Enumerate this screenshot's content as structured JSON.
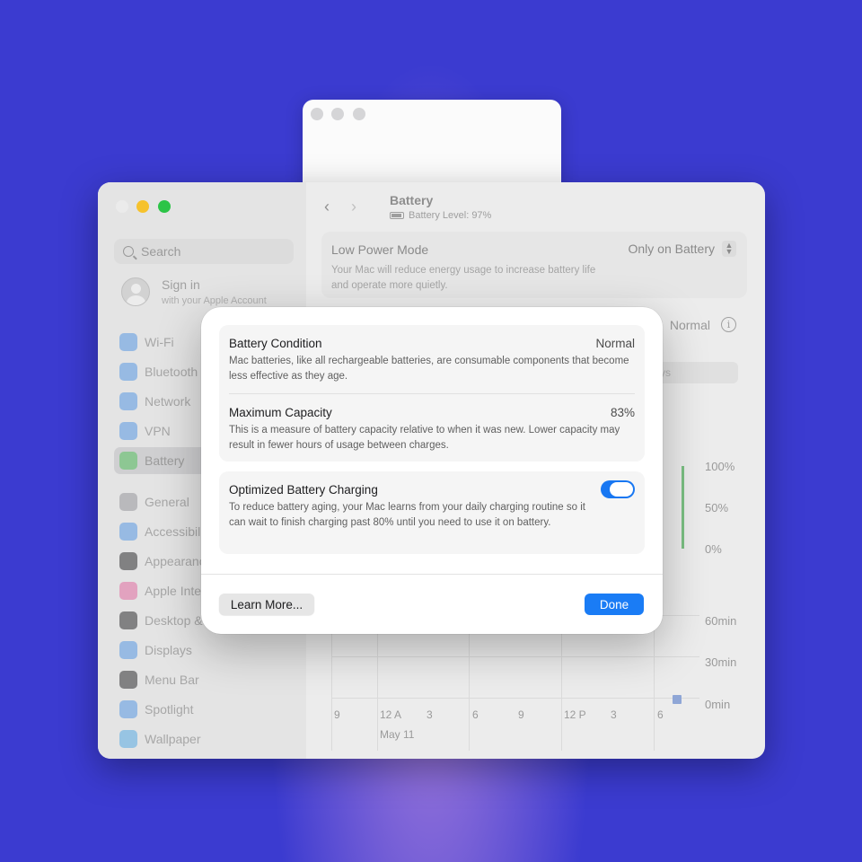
{
  "colors": {
    "accent": "#1a7cf5",
    "traffic_red": "#ebebeb",
    "traffic_yellow": "#f6c22d",
    "traffic_green": "#2cc447"
  },
  "window": {
    "title": "Battery",
    "battery_level": "Battery Level: 97%"
  },
  "sidebar": {
    "search_placeholder": "Search",
    "signin": {
      "title": "Sign in",
      "subtitle": "with your Apple Account"
    },
    "items": [
      {
        "label": "Wi-Fi",
        "icon": "wifi-icon",
        "color": "#4a90e2"
      },
      {
        "label": "Bluetooth",
        "icon": "bluetooth-icon",
        "color": "#4a90e2"
      },
      {
        "label": "Network",
        "icon": "globe-icon",
        "color": "#4a90e2"
      },
      {
        "label": "VPN",
        "icon": "vpn-icon",
        "color": "#4a90e2"
      },
      {
        "label": "Battery",
        "icon": "battery-icon",
        "color": "#4cbf56"
      },
      {
        "label": "General",
        "icon": "gear-icon",
        "color": "#8e8e93"
      },
      {
        "label": "Accessibil",
        "icon": "accessibility-icon",
        "color": "#4a90e2"
      },
      {
        "label": "Appearanc",
        "icon": "appearance-icon",
        "color": "#1d1d1f"
      },
      {
        "label": "Apple Inte",
        "icon": "apple-intelligence-icon",
        "color": "#e0609a"
      },
      {
        "label": "Desktop &",
        "icon": "desktop-icon",
        "color": "#1d1d1f"
      },
      {
        "label": "Displays",
        "icon": "display-icon",
        "color": "#4a90e2"
      },
      {
        "label": "Menu Bar",
        "icon": "menubar-icon",
        "color": "#1d1d1f"
      },
      {
        "label": "Spotlight",
        "icon": "spotlight-icon",
        "color": "#4a90e2"
      },
      {
        "label": "Wallpaper",
        "icon": "wallpaper-icon",
        "color": "#4aa3e2"
      }
    ]
  },
  "low_power": {
    "label": "Low Power Mode",
    "description": "Your Mac will reduce energy usage to increase battery life and operate more quietly.",
    "value": "Only on Battery"
  },
  "health": {
    "value": "Normal"
  },
  "segment_stub": "ys",
  "chart": {
    "level_ticks": [
      "100%",
      "50%",
      "0%"
    ],
    "usage_ticks": [
      "60min",
      "30min",
      "0min"
    ],
    "x_labels": [
      "9",
      "12 A",
      "3",
      "6",
      "9",
      "12 P",
      "3",
      "6"
    ],
    "date_label": "May 11"
  },
  "sheet": {
    "condition": {
      "title": "Battery Condition",
      "value": "Normal",
      "description": "Mac batteries, like all rechargeable batteries, are consumable components that become less effective as they age."
    },
    "capacity": {
      "title": "Maximum Capacity",
      "value": "83%",
      "description": "This is a measure of battery capacity relative to when it was new. Lower capacity may result in fewer hours of usage between charges."
    },
    "optimized": {
      "title": "Optimized Battery Charging",
      "enabled": true,
      "description": "To reduce battery aging, your Mac learns from your daily charging routine so it can wait to finish charging past 80% until you need to use it on battery."
    },
    "learn_more_label": "Learn More...",
    "done_label": "Done"
  }
}
